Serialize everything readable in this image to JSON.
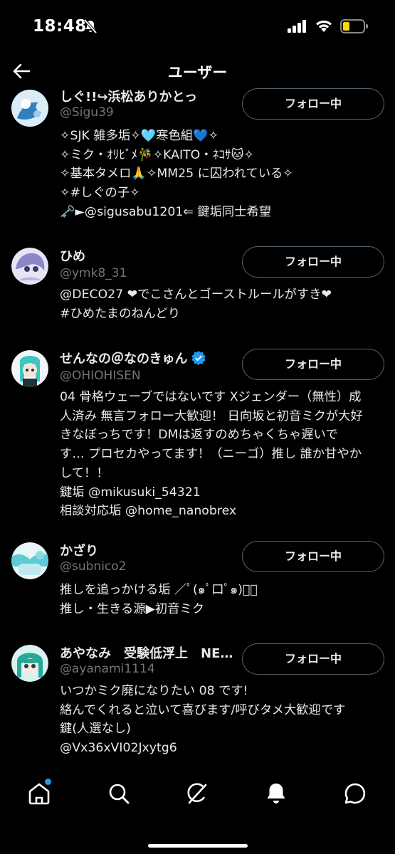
{
  "status_bar": {
    "time": "18:48"
  },
  "header": {
    "title": "ユーザー"
  },
  "users": [
    {
      "name": "しぐ!!↪浜松ありかとっ",
      "handle": "@Sigu39",
      "button": "フォロー中",
      "bio": [
        "✧SJK 雑多垢✧🩵寒色組💙✧",
        "✧ミク・ｵﾘﾋﾞﾒ🎋✧KAITO・ﾈｺｻ🐱✧",
        "✧基本タメロ🙏✧MM25 に囚われている✧",
        "✧#しぐの子✧",
        "🗝️►@sigusabu1201⇐ 鍵垢同士希望"
      ],
      "avatar_colors": [
        "#cfe6f5",
        "#2f7fc1",
        "#ffffff"
      ]
    },
    {
      "name": "ひめ",
      "handle": "@ymk8_31",
      "button": "フォロー中",
      "bio": [
        "@DECO27 ❤でこさんとゴーストルールがすき❤",
        "#ひめたまのねんどり"
      ],
      "avatar_colors": [
        "#e8e4f4",
        "#8a86c8",
        "#3c3a6a"
      ]
    },
    {
      "name": "せんなの＠なのきゅん",
      "handle": "@OHIOHISEN",
      "button": "フォロー中",
      "verified": true,
      "bio": [
        "04 骨格ウェーブではないです Xジェンダー（無性）成",
        "人済み 無言フォロー大歓迎！ 日向坂と初音ミクが大好",
        "きなぼっちです！DMは返すのめちゃくちゃ遅いで",
        "す… プロセカやってます！（ニーゴ）推し 誰か甘やか",
        "して！！",
        "鍵垢 @mikusuki_54321",
        "相談対応垢 @home_nanobrex"
      ],
      "avatar_colors": [
        "#f3f6f8",
        "#3ec6c0",
        "#20343c"
      ]
    },
    {
      "name": "かざり",
      "handle": "@subnico2",
      "button": "フォロー中",
      "bio": [
        "推しを追っかける垢 ／ﾟ(๑ﾟ口ﾟ๑)ﾟ＼",
        "推し・生きる源▶初音ミク"
      ],
      "avatar_colors": [
        "#bfe9ef",
        "#5fc9d4",
        "#e9f7f8"
      ]
    },
    {
      "name": "あやなみ　受験低浮上　NE…",
      "handle": "@ayanami1114",
      "button": "フォロー中",
      "bio": [
        "いつかミク廃になりたい 08 です!",
        "絡んでくれると泣いて喜びます/呼びタメ大歓迎です",
        "鍵(人選なし)",
        "@Vx36xVI02Jxytg6"
      ],
      "avatar_colors": [
        "#d9f2ee",
        "#23a89a",
        "#2a3b46"
      ]
    }
  ],
  "nav": {
    "icons": [
      "home-icon",
      "search-icon",
      "grok-icon",
      "notifications-icon",
      "messages-icon"
    ],
    "accent": "#1d9bf0"
  }
}
